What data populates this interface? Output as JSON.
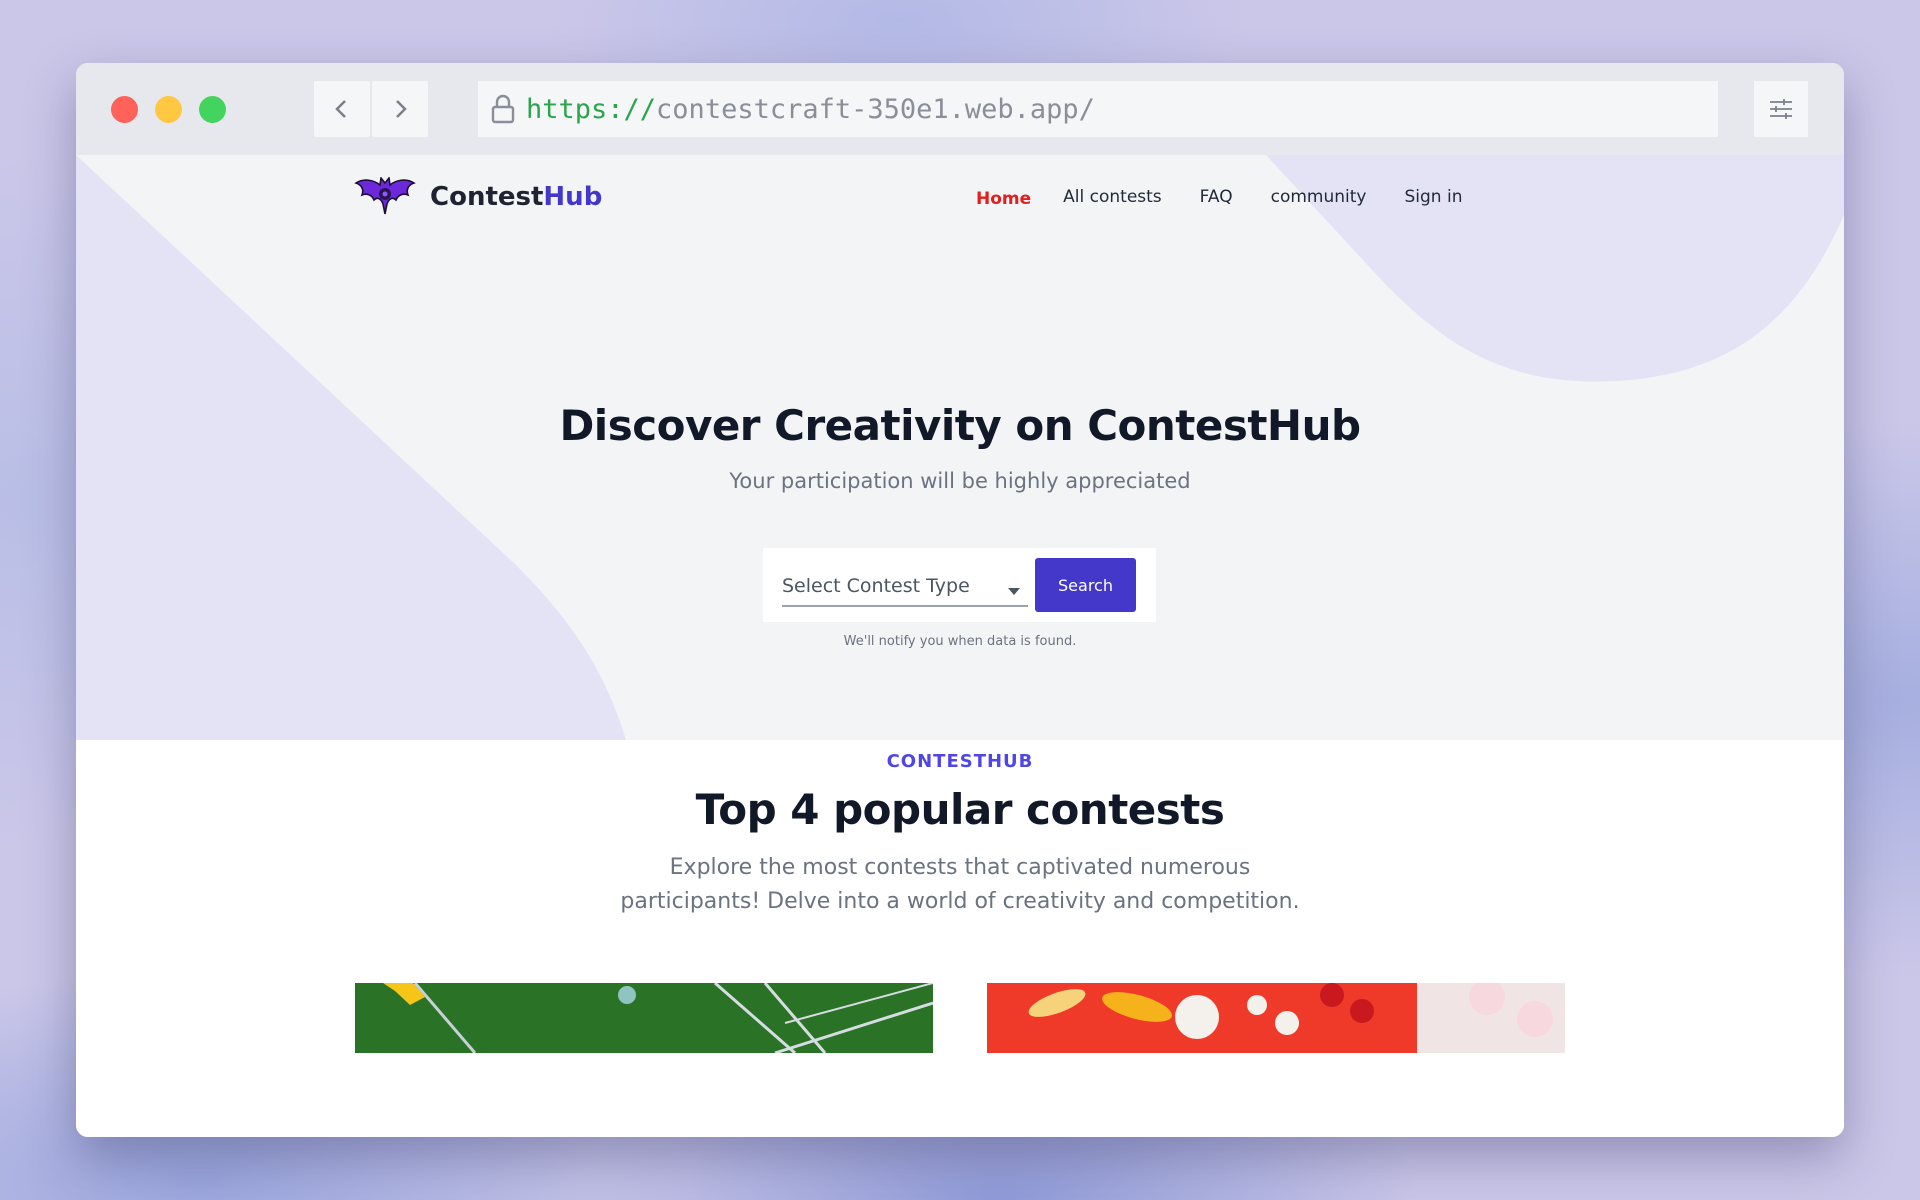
{
  "browser": {
    "url_scheme": "https://",
    "url_rest": "contestcraft-350e1.web.app/"
  },
  "header": {
    "logo_text_1": "Contest",
    "logo_text_2": "Hub",
    "nav": [
      "Home",
      "All contests",
      "FAQ",
      "community",
      "Sign in"
    ]
  },
  "hero": {
    "title": "Discover Creativity on ContestHub",
    "subtitle": "Your participation will be highly appreciated",
    "select_placeholder": "Select Contest Type",
    "search_label": "Search",
    "notify_text": "We'll notify you when data is found."
  },
  "popular": {
    "tag": "CONTESTHUB",
    "title": "Top 4 popular contests",
    "description": "Explore the most contests that captivated numerous participants! Delve into a world of creativity and competition."
  },
  "colors": {
    "accent": "#4338ca",
    "active_nav": "#e11d1d"
  }
}
